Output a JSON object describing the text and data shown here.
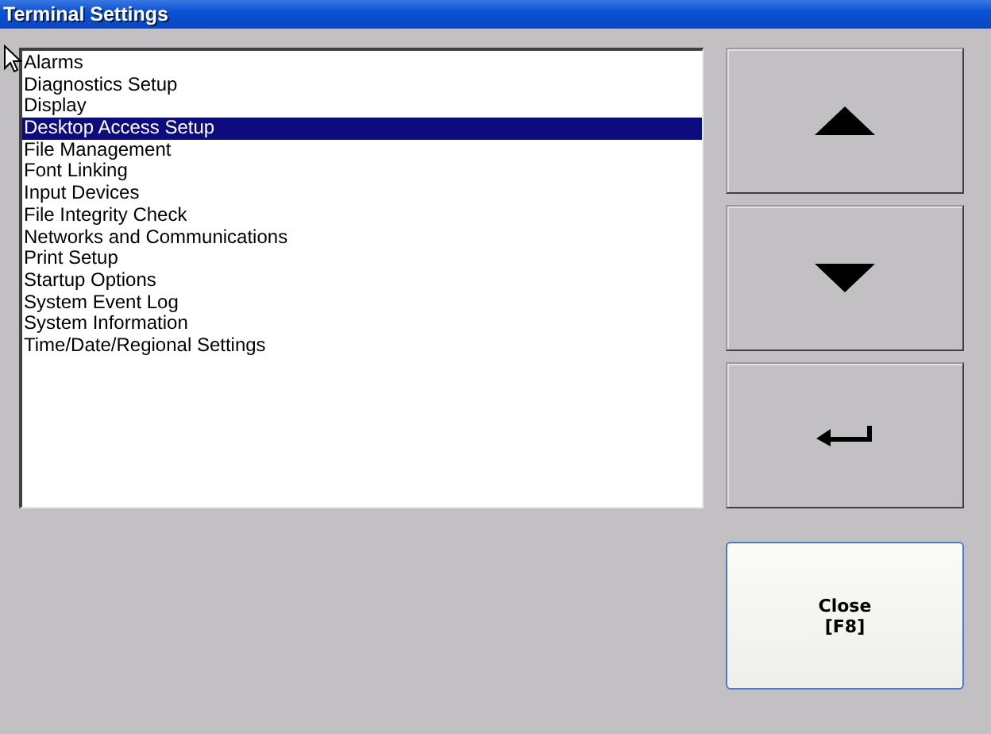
{
  "window": {
    "title": "Terminal Settings"
  },
  "list": {
    "items": [
      {
        "label": "Alarms",
        "selected": false
      },
      {
        "label": "Diagnostics Setup",
        "selected": false
      },
      {
        "label": "Display",
        "selected": false
      },
      {
        "label": "Desktop Access Setup",
        "selected": true
      },
      {
        "label": "File Management",
        "selected": false
      },
      {
        "label": "Font Linking",
        "selected": false
      },
      {
        "label": "Input Devices",
        "selected": false
      },
      {
        "label": "File Integrity Check",
        "selected": false
      },
      {
        "label": "Networks and Communications",
        "selected": false
      },
      {
        "label": "Print Setup",
        "selected": false
      },
      {
        "label": "Startup Options",
        "selected": false
      },
      {
        "label": "System Event Log",
        "selected": false
      },
      {
        "label": "System Information",
        "selected": false
      },
      {
        "label": "Time/Date/Regional Settings",
        "selected": false
      }
    ]
  },
  "nav_buttons": [
    {
      "kind": "up"
    },
    {
      "kind": "down"
    },
    {
      "kind": "enter"
    }
  ],
  "close_button": {
    "label": "Close",
    "key": "[F8]"
  }
}
